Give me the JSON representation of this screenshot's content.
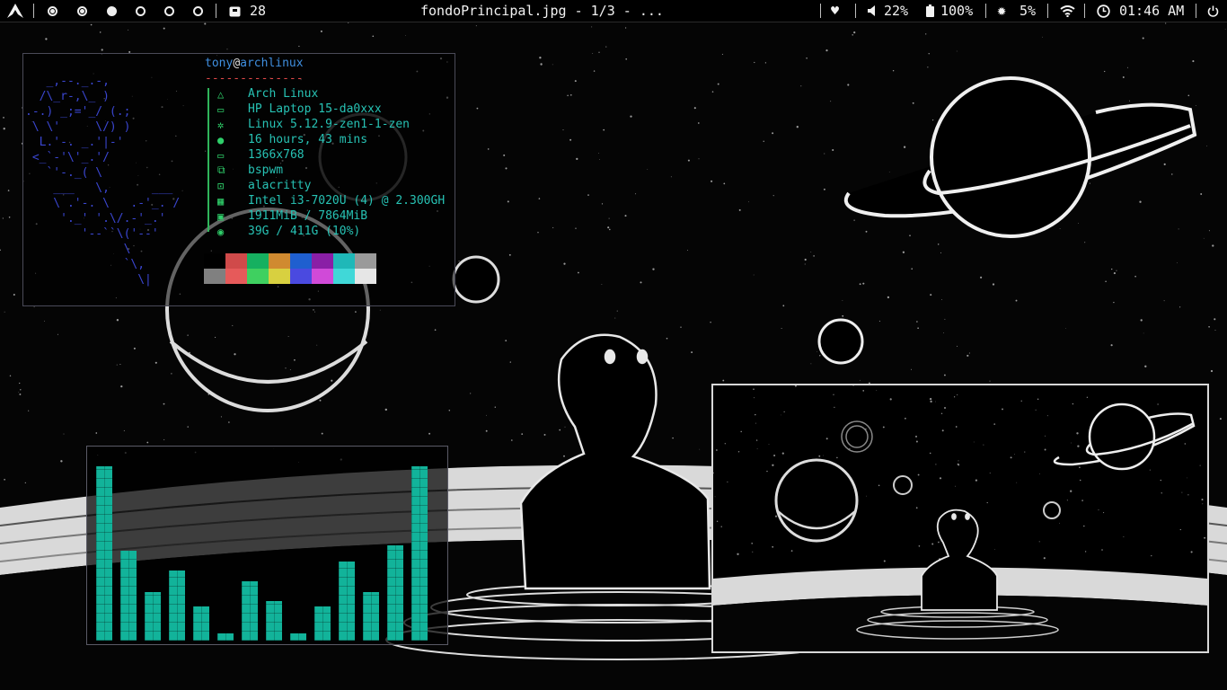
{
  "topbar": {
    "workspace_count": "28",
    "window_title": "fondoPrincipal.jpg - 1/3 - ...",
    "volume": "22%",
    "battery": "100%",
    "brightness": "5%",
    "clock": "01:46 AM"
  },
  "neofetch": {
    "user": "tony",
    "at": "@",
    "host": "archlinux",
    "rule": "--------------",
    "ascii": "   _,--._.-,\n  /\\_r-,\\_ )\n.-.) _;='_/ (.;\n \\ \\'     \\/) )\n  L.'-. _.'|-'\n <_`-'\\'_.'/\n   `'-._( \\\n    ___   \\,      ___\n    \\ .'-. \\   .-'_. /\n     '._' '.\\/.-'_.'\n        '--``\\('--'\n              \\\n              `\\,\n                \\|",
    "rows": [
      {
        "icon": "arch-icon",
        "glyph": "△",
        "text": "Arch Linux"
      },
      {
        "icon": "laptop-icon",
        "glyph": "▭",
        "text": "HP Laptop 15-da0xxx"
      },
      {
        "icon": "gear-icon",
        "glyph": "✲",
        "text": "Linux 5.12.9-zen1-1-zen"
      },
      {
        "icon": "bulb-icon",
        "glyph": "●",
        "text": "16 hours, 43 mins"
      },
      {
        "icon": "monitor-icon",
        "glyph": "▭",
        "text": "1366x768"
      },
      {
        "icon": "windows-icon",
        "glyph": "⧉",
        "text": "bspwm"
      },
      {
        "icon": "terminal-icon",
        "glyph": "⊡",
        "text": "alacritty"
      },
      {
        "icon": "cpu-icon",
        "glyph": "▦",
        "text": "Intel i3-7020U (4) @ 2.300GH"
      },
      {
        "icon": "memory-icon",
        "glyph": "▣",
        "text": "1911MiB / 7864MiB"
      },
      {
        "icon": "disk-icon",
        "glyph": "◉",
        "text": "39G / 411G (10%)"
      }
    ],
    "swatches_top": [
      "#000000",
      "#d04a4a",
      "#16b060",
      "#d08a30",
      "#1f5fcf",
      "#8a1fa6",
      "#1fb8b8",
      "#9a9a9a"
    ],
    "swatches_bottom": [
      "#808080",
      "#e65a5a",
      "#3fd060",
      "#d8d040",
      "#4a4ae0",
      "#d04ad8",
      "#40d8d8",
      "#e6e6e6"
    ]
  },
  "visualizer": {
    "color": "#12b39a",
    "levels": [
      0.97,
      0.5,
      0.27,
      0.39,
      0.19,
      0.04,
      0.33,
      0.22,
      0.04,
      0.19,
      0.44,
      0.27,
      0.53,
      0.97
    ]
  },
  "theme": {
    "accent": "#27c2b4",
    "ascii_color": "#3a46d0",
    "border": "#4a4a58"
  }
}
